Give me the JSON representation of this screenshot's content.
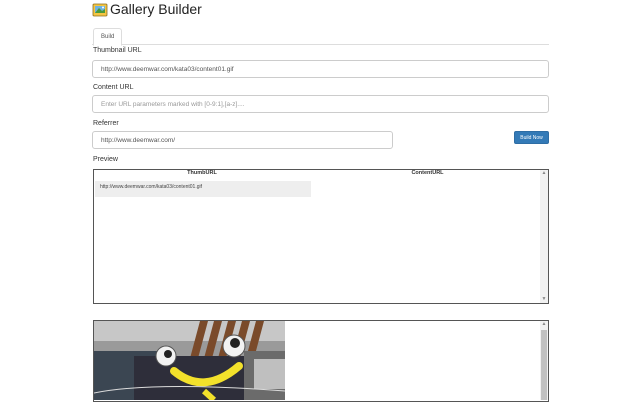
{
  "app": {
    "title": "Gallery Builder",
    "logo_icon": "gallery-builder-logo"
  },
  "tabs": [
    {
      "label": "Build",
      "active": true
    }
  ],
  "form": {
    "thumbnail_url": {
      "label": "Thumbnail URL",
      "value": "http://www.deemwar.com/kata03/content01.gif"
    },
    "content_url": {
      "label": "Content URL",
      "value": "",
      "placeholder": "Enter URL parameters marked with [0-9:1],[a-z]...."
    },
    "referrer": {
      "label": "Referrer",
      "value": "http://www.deemwar.com/"
    },
    "build_button": {
      "label": "Build Now",
      "color": "#337ab7"
    }
  },
  "preview": {
    "label": "Preview",
    "columns": [
      "ThumbURL",
      "ContentURL"
    ],
    "rows": [
      {
        "thumb": "http://www.deemwar.com/kata03/content01.gif",
        "content": ""
      }
    ]
  },
  "icons": {
    "scroll_up": "▲",
    "scroll_down": "▼"
  }
}
